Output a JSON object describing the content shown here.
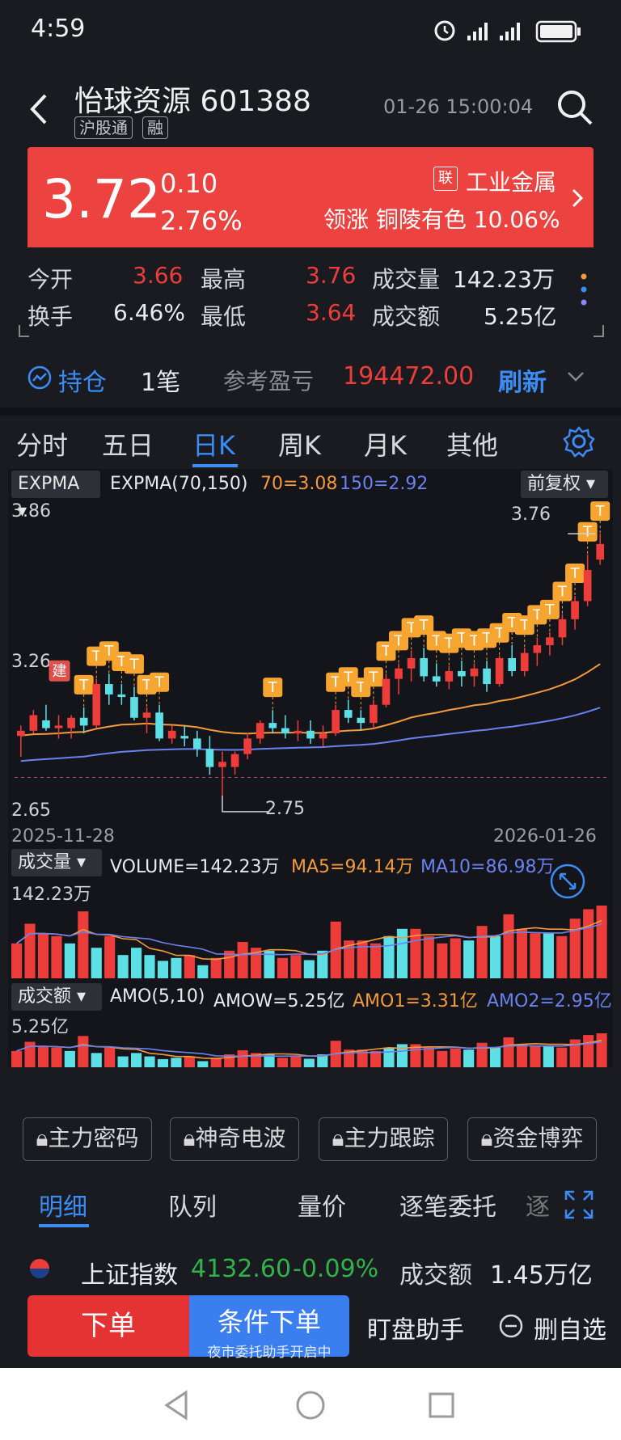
{
  "status_bar": {
    "time": "4:59"
  },
  "header": {
    "stock_name": "怡球资源 601388",
    "tags": [
      "沪股通",
      "融"
    ],
    "datetime": "01-26 15:00:04"
  },
  "quote": {
    "price": "3.72",
    "change": "0.10",
    "change_pct": "2.76%",
    "sector_badge": "联",
    "sector_name": "工业金属",
    "sector_lead": "领涨 铜陵有色 10.06%"
  },
  "stats": {
    "open_label": "今开",
    "open_value": "3.66",
    "high_label": "最高",
    "high_value": "3.76",
    "volume_label": "成交量",
    "volume_value": "142.23万",
    "turnover_label": "换手",
    "turnover_value": "6.46%",
    "low_label": "最低",
    "low_value": "3.64",
    "amount_label": "成交额",
    "amount_value": "5.25亿"
  },
  "holding": {
    "label": "持仓",
    "count": "1笔",
    "pnl_label": "参考盈亏",
    "pnl_value": "194472.00",
    "refresh": "刷新"
  },
  "tabs": [
    {
      "label": "分时"
    },
    {
      "label": "五日"
    },
    {
      "label": "日K"
    },
    {
      "label": "周K"
    },
    {
      "label": "月K"
    },
    {
      "label": "其他"
    }
  ],
  "main_chart": {
    "indicator_dd": "EXPMA",
    "indicator_name": "EXPMA(70,150)",
    "line70": "70=3.08",
    "line150": "150=2.92",
    "adjust_dd": "前复权",
    "y_top": "3.86",
    "y_mid": "3.26",
    "y_bottom": "2.65",
    "high_mark": "3.76",
    "low_mark": "2.75",
    "build_mark": "建",
    "t_mark": "T",
    "date_start": "2025-11-28",
    "date_end": "2026-01-26"
  },
  "volume_panel": {
    "dd": "成交量",
    "volume_text": "VOLUME=142.23万",
    "ma5": "MA5=94.14万",
    "ma10": "MA10=86.98万",
    "max_label": "142.23万"
  },
  "amount_panel": {
    "dd": "成交额",
    "amo_text": "AMO(5,10)",
    "amow": "AMOW=5.25亿",
    "amo1": "AMO1=3.31亿",
    "amo2": "AMO2=2.95亿",
    "max_label": "5.25亿"
  },
  "tools": [
    "主力密码",
    "神奇电波",
    "主力跟踪",
    "资金博弈"
  ],
  "detail_tabs": [
    "明细",
    "队列",
    "量价",
    "逐笔委托",
    "逐"
  ],
  "index_row": {
    "name": "上证指数",
    "value": "4132.60",
    "change": "-0.09%",
    "amount_label": "成交额",
    "amount_value": "1.45万亿"
  },
  "actions": {
    "order": "下单",
    "conditional": "条件下单",
    "conditional_sub": "夜市委托助手开启中",
    "assistant": "盯盘助手",
    "remove_fav": "删自选"
  },
  "colors": {
    "up": "#ec3d3a",
    "down": "#5ce0e6",
    "accent": "#3b8cf5",
    "ema70": "#f39a3c",
    "ema150": "#6a82f0"
  },
  "chart_data": {
    "type": "candlestick",
    "date_range": [
      "2025-11-28",
      "2026-01-26"
    ],
    "ylim": [
      2.65,
      3.86
    ],
    "candles": [
      {
        "o": 2.98,
        "h": 3.02,
        "l": 2.9,
        "c": 3.0
      },
      {
        "o": 3.0,
        "h": 3.08,
        "l": 2.99,
        "c": 3.06
      },
      {
        "o": 3.04,
        "h": 3.1,
        "l": 3.0,
        "c": 3.01
      },
      {
        "o": 3.01,
        "h": 3.06,
        "l": 2.97,
        "c": 3.02
      },
      {
        "o": 3.01,
        "h": 3.06,
        "l": 2.97,
        "c": 3.05
      },
      {
        "o": 3.05,
        "h": 3.09,
        "l": 2.99,
        "c": 3.02
      },
      {
        "o": 3.02,
        "h": 3.2,
        "l": 3.01,
        "c": 3.18
      },
      {
        "o": 3.18,
        "h": 3.22,
        "l": 3.1,
        "c": 3.14
      },
      {
        "o": 3.14,
        "h": 3.18,
        "l": 3.1,
        "c": 3.13
      },
      {
        "o": 3.13,
        "h": 3.17,
        "l": 3.04,
        "c": 3.05
      },
      {
        "o": 3.05,
        "h": 3.09,
        "l": 2.99,
        "c": 3.07
      },
      {
        "o": 3.07,
        "h": 3.1,
        "l": 2.96,
        "c": 2.97
      },
      {
        "o": 2.97,
        "h": 3.02,
        "l": 2.95,
        "c": 3.0
      },
      {
        "o": 2.98,
        "h": 3.02,
        "l": 2.94,
        "c": 2.97
      },
      {
        "o": 2.97,
        "h": 3.0,
        "l": 2.9,
        "c": 2.93
      },
      {
        "o": 2.93,
        "h": 2.98,
        "l": 2.83,
        "c": 2.86
      },
      {
        "o": 2.86,
        "h": 2.92,
        "l": 2.75,
        "c": 2.88
      },
      {
        "o": 2.86,
        "h": 2.92,
        "l": 2.83,
        "c": 2.91
      },
      {
        "o": 2.91,
        "h": 2.99,
        "l": 2.89,
        "c": 2.97
      },
      {
        "o": 2.97,
        "h": 3.04,
        "l": 2.95,
        "c": 3.03
      },
      {
        "o": 3.03,
        "h": 3.08,
        "l": 2.99,
        "c": 3.01
      },
      {
        "o": 3.01,
        "h": 3.06,
        "l": 2.97,
        "c": 2.99
      },
      {
        "o": 2.99,
        "h": 3.04,
        "l": 2.96,
        "c": 3.0
      },
      {
        "o": 3.0,
        "h": 3.04,
        "l": 2.95,
        "c": 2.97
      },
      {
        "o": 2.97,
        "h": 3.02,
        "l": 2.94,
        "c": 2.99
      },
      {
        "o": 2.99,
        "h": 3.1,
        "l": 2.98,
        "c": 3.08
      },
      {
        "o": 3.08,
        "h": 3.12,
        "l": 3.03,
        "c": 3.05
      },
      {
        "o": 3.05,
        "h": 3.08,
        "l": 3.0,
        "c": 3.03
      },
      {
        "o": 3.03,
        "h": 3.12,
        "l": 3.01,
        "c": 3.1
      },
      {
        "o": 3.1,
        "h": 3.22,
        "l": 3.09,
        "c": 3.2
      },
      {
        "o": 3.2,
        "h": 3.26,
        "l": 3.14,
        "c": 3.24
      },
      {
        "o": 3.24,
        "h": 3.31,
        "l": 3.19,
        "c": 3.28
      },
      {
        "o": 3.28,
        "h": 3.32,
        "l": 3.19,
        "c": 3.21
      },
      {
        "o": 3.21,
        "h": 3.26,
        "l": 3.17,
        "c": 3.19
      },
      {
        "o": 3.19,
        "h": 3.25,
        "l": 3.16,
        "c": 3.23
      },
      {
        "o": 3.23,
        "h": 3.27,
        "l": 3.17,
        "c": 3.21
      },
      {
        "o": 3.21,
        "h": 3.26,
        "l": 3.17,
        "c": 3.24
      },
      {
        "o": 3.24,
        "h": 3.27,
        "l": 3.15,
        "c": 3.18
      },
      {
        "o": 3.18,
        "h": 3.29,
        "l": 3.17,
        "c": 3.28
      },
      {
        "o": 3.28,
        "h": 3.33,
        "l": 3.21,
        "c": 3.23
      },
      {
        "o": 3.23,
        "h": 3.32,
        "l": 3.21,
        "c": 3.3
      },
      {
        "o": 3.3,
        "h": 3.36,
        "l": 3.25,
        "c": 3.33
      },
      {
        "o": 3.33,
        "h": 3.38,
        "l": 3.29,
        "c": 3.36
      },
      {
        "o": 3.36,
        "h": 3.45,
        "l": 3.33,
        "c": 3.43
      },
      {
        "o": 3.43,
        "h": 3.52,
        "l": 3.39,
        "c": 3.5
      },
      {
        "o": 3.5,
        "h": 3.68,
        "l": 3.48,
        "c": 3.62
      },
      {
        "o": 3.66,
        "h": 3.76,
        "l": 3.64,
        "c": 3.72
      }
    ],
    "volume_rel": [
      0.48,
      0.75,
      0.62,
      0.58,
      0.48,
      0.92,
      0.42,
      0.58,
      0.32,
      0.42,
      0.32,
      0.24,
      0.28,
      0.32,
      0.18,
      0.28,
      0.38,
      0.5,
      0.42,
      0.38,
      0.28,
      0.32,
      0.25,
      0.38,
      0.78,
      0.52,
      0.52,
      0.48,
      0.58,
      0.68,
      0.68,
      0.58,
      0.48,
      0.55,
      0.52,
      0.72,
      0.58,
      0.88,
      0.68,
      0.62,
      0.62,
      0.58,
      0.82,
      0.95,
      1.0
    ],
    "volume_up": [
      1,
      1,
      1,
      1,
      0,
      1,
      0,
      1,
      0,
      0,
      0,
      0,
      0,
      1,
      0,
      1,
      1,
      1,
      1,
      0,
      1,
      1,
      0,
      0,
      1,
      1,
      1,
      1,
      0,
      0,
      1,
      1,
      1,
      1,
      0,
      1,
      0,
      1,
      1,
      1,
      0,
      1,
      1,
      1,
      1
    ]
  }
}
